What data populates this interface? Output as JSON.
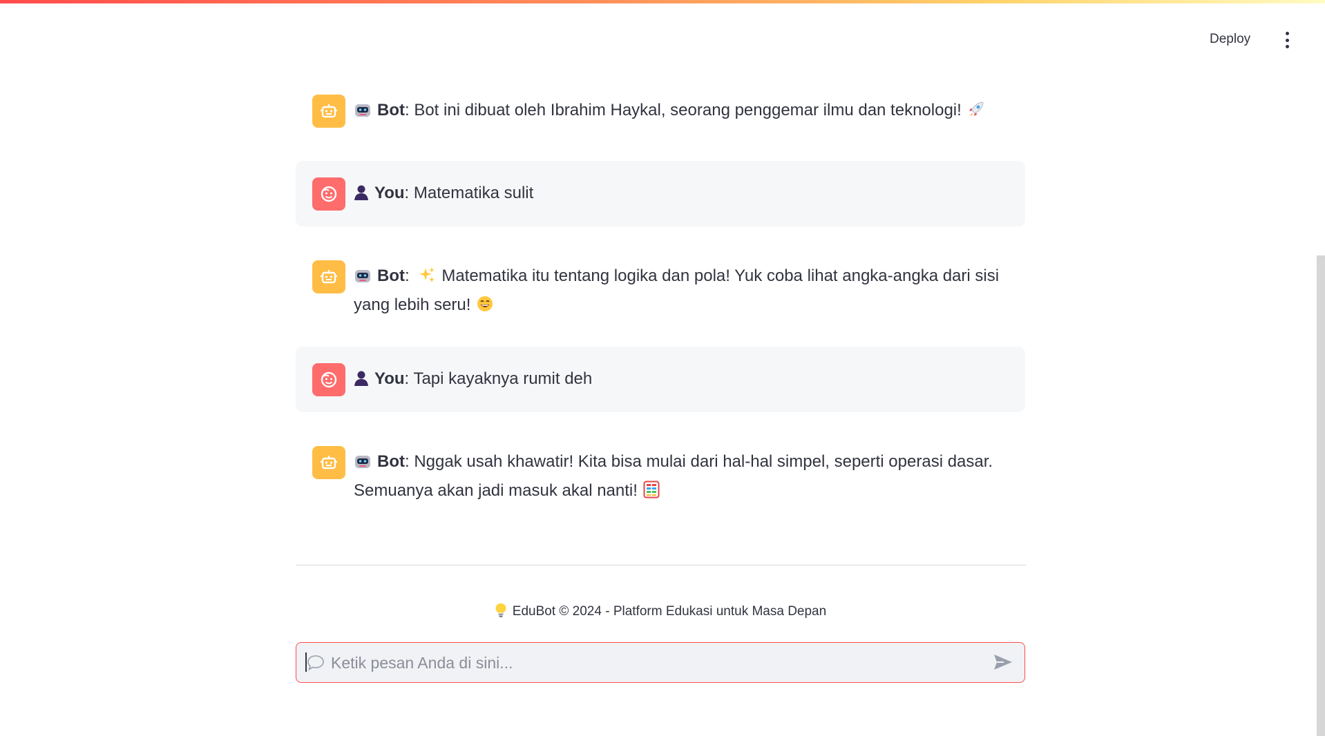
{
  "header": {
    "deploy_label": "Deploy",
    "menu_icon": "kebab-menu-icon"
  },
  "messages": [
    {
      "role": "bot",
      "avatar_icon": "robot-face-icon",
      "speaker": "Bot",
      "lead_emojis": "robot-emoji",
      "text": ": Bot ini dibuat oleh Ibrahim Haykal, seorang penggemar ilmu dan teknologi!",
      "trail_emoji": "rocket-emoji"
    },
    {
      "role": "user",
      "avatar_icon": "smiley-face-icon",
      "speaker": "You",
      "lead_emojis": "person-silhouette-emoji",
      "text": ": Matematika sulit"
    },
    {
      "role": "bot",
      "avatar_icon": "robot-face-icon",
      "speaker": "Bot",
      "lead_emojis": "robot-emoji",
      "text_prefix": ": ",
      "text": "Matematika itu tentang logika dan pola! Yuk coba lihat angka-angka dari sisi yang lebih seru!",
      "inline_emoji": "sparkles-emoji",
      "trail_emoji": "grinning-face-emoji"
    },
    {
      "role": "user",
      "avatar_icon": "smiley-face-icon",
      "speaker": "You",
      "lead_emojis": "person-silhouette-emoji",
      "text": ": Tapi kayaknya rumit deh"
    },
    {
      "role": "bot",
      "avatar_icon": "robot-face-icon",
      "speaker": "Bot",
      "lead_emojis": "robot-emoji",
      "text": ": Nggak usah khawatir! Kita bisa mulai dari hal-hal simpel, seperti operasi dasar. Semuanya akan jadi masuk akal nanti!",
      "trail_emoji": "abacus-emoji"
    }
  ],
  "footer": {
    "icon": "light-bulb-icon",
    "text": "EduBot © 2024 - Platform Edukasi untuk Masa Depan"
  },
  "chat_input": {
    "placeholder": "Ketik pesan Anda di sini...",
    "value": "",
    "leading_icon": "speech-bubble-icon",
    "send_icon": "send-arrow-icon"
  },
  "colors": {
    "accent": "#ff4b4b",
    "bot_avatar": "#ffbd45",
    "user_avatar": "#ff6c6c",
    "user_bubble": "#f6f7f9",
    "text": "#31333f"
  }
}
